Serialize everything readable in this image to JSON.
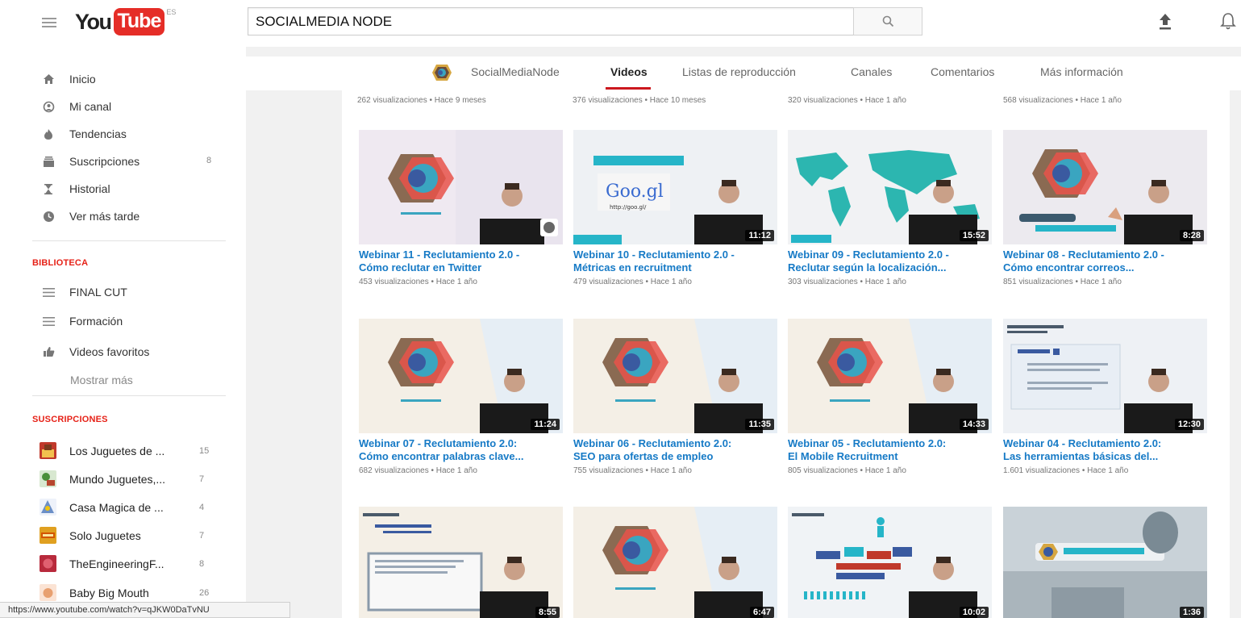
{
  "masthead": {
    "logo_you": "You",
    "logo_tube": "Tube",
    "logo_country": "ES",
    "search_value": "SOCIALMEDIA NODE"
  },
  "guide": {
    "main_items": [
      {
        "label": "Inicio",
        "icon": "home-icon"
      },
      {
        "label": "Mi canal",
        "icon": "user-icon"
      },
      {
        "label": "Tendencias",
        "icon": "flame-icon"
      },
      {
        "label": "Suscripciones",
        "icon": "subscriptions-icon",
        "count": "8"
      },
      {
        "label": "Historial",
        "icon": "hourglass-icon"
      },
      {
        "label": "Ver más tarde",
        "icon": "clock-icon"
      }
    ],
    "library_title": "BIBLIOTECA",
    "library_items": [
      {
        "label": "FINAL CUT",
        "icon": "playlist-icon"
      },
      {
        "label": "Formación",
        "icon": "playlist-icon"
      },
      {
        "label": "Videos favoritos",
        "icon": "thumbs-up-icon"
      }
    ],
    "show_more": "Mostrar más",
    "subs_title": "SUSCRIPCIONES",
    "subscriptions": [
      {
        "label": "Los Juguetes de ...",
        "count": "15",
        "color": "#c0392b"
      },
      {
        "label": "Mundo Juguetes,...",
        "count": "7",
        "color": "#4a8f3a"
      },
      {
        "label": "Casa Magica de ...",
        "count": "4",
        "color": "#6b8fc7"
      },
      {
        "label": "Solo Juguetes",
        "count": "7",
        "color": "#e0a020"
      },
      {
        "label": "TheEngineeringF...",
        "count": "8",
        "color": "#b82a3c"
      },
      {
        "label": "Baby Big Mouth",
        "count": "26",
        "color": "#e8a070"
      }
    ]
  },
  "channel_nav": {
    "channel_name": "SocialMediaNode",
    "tabs": [
      "Videos",
      "Listas de reproducción",
      "Canales",
      "Comentarios",
      "Más información"
    ]
  },
  "top_row_meta": [
    "262 visualizaciones • Hace 9 meses",
    "376 visualizaciones • Hace 10 meses",
    "320 visualizaciones • Hace 1 año",
    "568 visualizaciones • Hace 1 año"
  ],
  "videos": [
    {
      "title1": "Webinar 11 - Reclutamiento 2.0 -",
      "title2": "Cómo reclutar en Twitter",
      "meta": "453 visualizaciones • Hace 1 año",
      "duration": ""
    },
    {
      "title1": "Webinar 10 - Reclutamiento 2.0 -",
      "title2": "Métricas en recruitment",
      "meta": "479 visualizaciones • Hace 1 año",
      "duration": "11:12"
    },
    {
      "title1": "Webinar 09 - Reclutamiento 2.0 -",
      "title2": "Reclutar según la localización...",
      "meta": "303 visualizaciones • Hace 1 año",
      "duration": "15:52"
    },
    {
      "title1": "Webinar 08 - Reclutamiento 2.0 -",
      "title2": "Cómo encontrar correos...",
      "meta": "851 visualizaciones • Hace 1 año",
      "duration": "8:28"
    },
    {
      "title1": "Webinar 07 - Reclutamiento 2.0:",
      "title2": "Cómo encontrar palabras clave...",
      "meta": "682 visualizaciones • Hace 1 año",
      "duration": "11:24"
    },
    {
      "title1": "Webinar 06 - Reclutamiento 2.0:",
      "title2": "SEO para ofertas de empleo",
      "meta": "755 visualizaciones • Hace 1 año",
      "duration": "11:35"
    },
    {
      "title1": "Webinar 05 - Reclutamiento 2.0:",
      "title2": "El Mobile Recruitment",
      "meta": "805 visualizaciones • Hace 1 año",
      "duration": "14:33"
    },
    {
      "title1": "Webinar 04 - Reclutamiento 2.0:",
      "title2": "Las herramientas básicas del...",
      "meta": "1.601 visualizaciones • Hace 1 año",
      "duration": "12:30"
    },
    {
      "title1": "",
      "title2": "",
      "meta": "",
      "duration": "8:55"
    },
    {
      "title1": "",
      "title2": "",
      "meta": "",
      "duration": "6:47"
    },
    {
      "title1": "",
      "title2": "",
      "meta": "",
      "duration": "10:02"
    },
    {
      "title1": "",
      "title2": "",
      "meta": "",
      "duration": "1:36"
    }
  ],
  "thumb_text": {
    "googl": "Goo.gl",
    "googl_url": "http://goo.gl/"
  },
  "status_url": "https://www.youtube.com/watch?v=qJKW0DaTvNU",
  "colors": {
    "brand_red": "#e52d27",
    "link_blue": "#167ac6",
    "section_red": "#e62117",
    "tab_underline": "#cc181e"
  }
}
